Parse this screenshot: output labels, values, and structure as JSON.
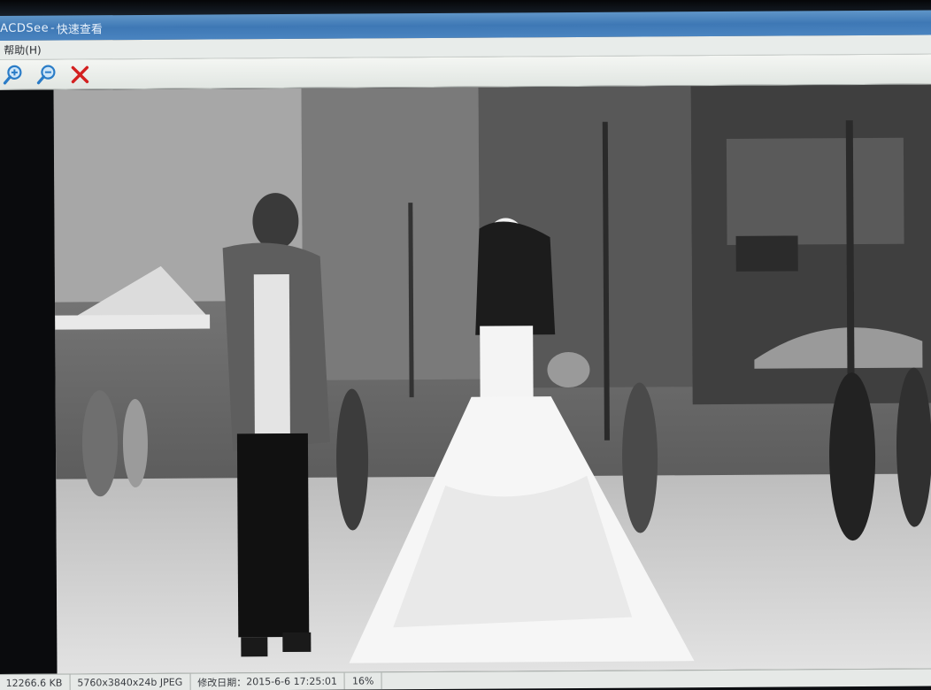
{
  "window": {
    "app_name": "ACDSee",
    "separator": "-",
    "title": "快速查看"
  },
  "menu": {
    "items": [
      {
        "label": "帮助(H)"
      }
    ]
  },
  "toolbar": {
    "buttons": [
      {
        "icon": "zoom-in-icon"
      },
      {
        "icon": "zoom-out-icon"
      },
      {
        "icon": "close-icon"
      }
    ]
  },
  "colors": {
    "titlebar": "#4a84c0",
    "close_red": "#d32020",
    "zoom_blue": "#2a7cc7"
  },
  "status": {
    "file_size": "12266.6 KB",
    "dimensions": "5760x3840x24b JPEG",
    "modified_label": "修改日期：",
    "modified_value": "2015-6-6 17:25:01",
    "zoom": "16%"
  }
}
